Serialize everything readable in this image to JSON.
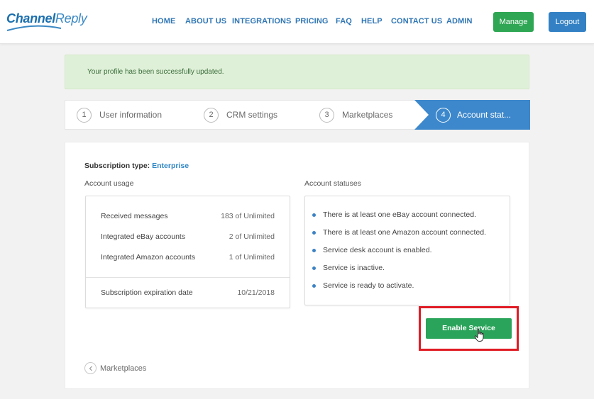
{
  "header": {
    "logo_part1": "Channel",
    "logo_part2": "Reply",
    "nav": [
      "HOME",
      "ABOUT US",
      "INTEGRATIONS",
      "PRICING",
      "FAQ",
      "HELP",
      "CONTACT US",
      "ADMIN"
    ],
    "manage_label": "Manage",
    "logout_label": "Logout"
  },
  "alert": {
    "message": "Your profile has been successfully updated."
  },
  "steps": [
    {
      "num": "1",
      "label": "User information"
    },
    {
      "num": "2",
      "label": "CRM settings"
    },
    {
      "num": "3",
      "label": "Marketplaces"
    },
    {
      "num": "4",
      "label": "Account stat..."
    }
  ],
  "subscription": {
    "label": "Subscription type:",
    "value": "Enterprise"
  },
  "usage": {
    "title": "Account usage",
    "rows": [
      {
        "label": "Received messages",
        "value": "183 of Unlimited"
      },
      {
        "label": "Integrated eBay accounts",
        "value": "2 of Unlimited"
      },
      {
        "label": "Integrated Amazon accounts",
        "value": "1 of Unlimited"
      }
    ],
    "expiration": {
      "label": "Subscription expiration date",
      "value": "10/21/2018"
    }
  },
  "statuses": {
    "title": "Account statuses",
    "items": [
      "There is at least one eBay account connected.",
      "There is at least one Amazon account connected.",
      "Service desk account is enabled.",
      "Service is inactive.",
      "Service is ready to activate."
    ]
  },
  "enable_button": "Enable Service",
  "back_link": "Marketplaces",
  "colors": {
    "accent": "#3d88cc",
    "success": "#2aa45a",
    "highlight": "#e01b24",
    "alert_bg": "#dff0d8"
  }
}
